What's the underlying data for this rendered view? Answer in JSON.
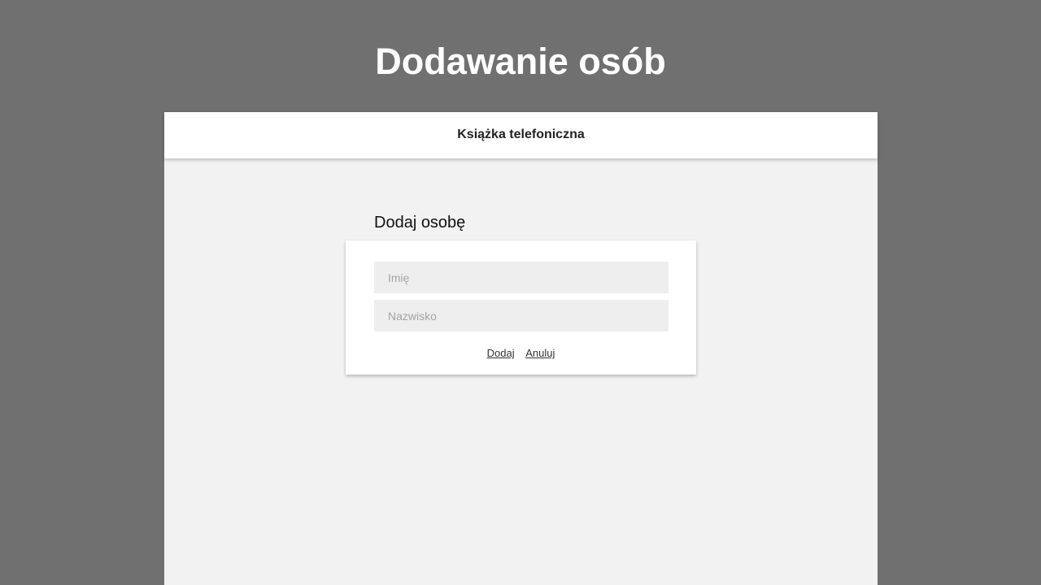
{
  "slide": {
    "title": "Dodawanie osób"
  },
  "app": {
    "header_title": "Książka telefoniczna"
  },
  "form": {
    "heading": "Dodaj osobę",
    "first_name": {
      "value": "",
      "placeholder": "Imię"
    },
    "last_name": {
      "value": "",
      "placeholder": "Nazwisko"
    },
    "add_label": "Dodaj",
    "cancel_label": "Anuluj"
  },
  "colors": {
    "page_background": "#707070",
    "app_background": "#f2f2f2",
    "header_background": "#ffffff",
    "input_background": "#eeeeee"
  }
}
